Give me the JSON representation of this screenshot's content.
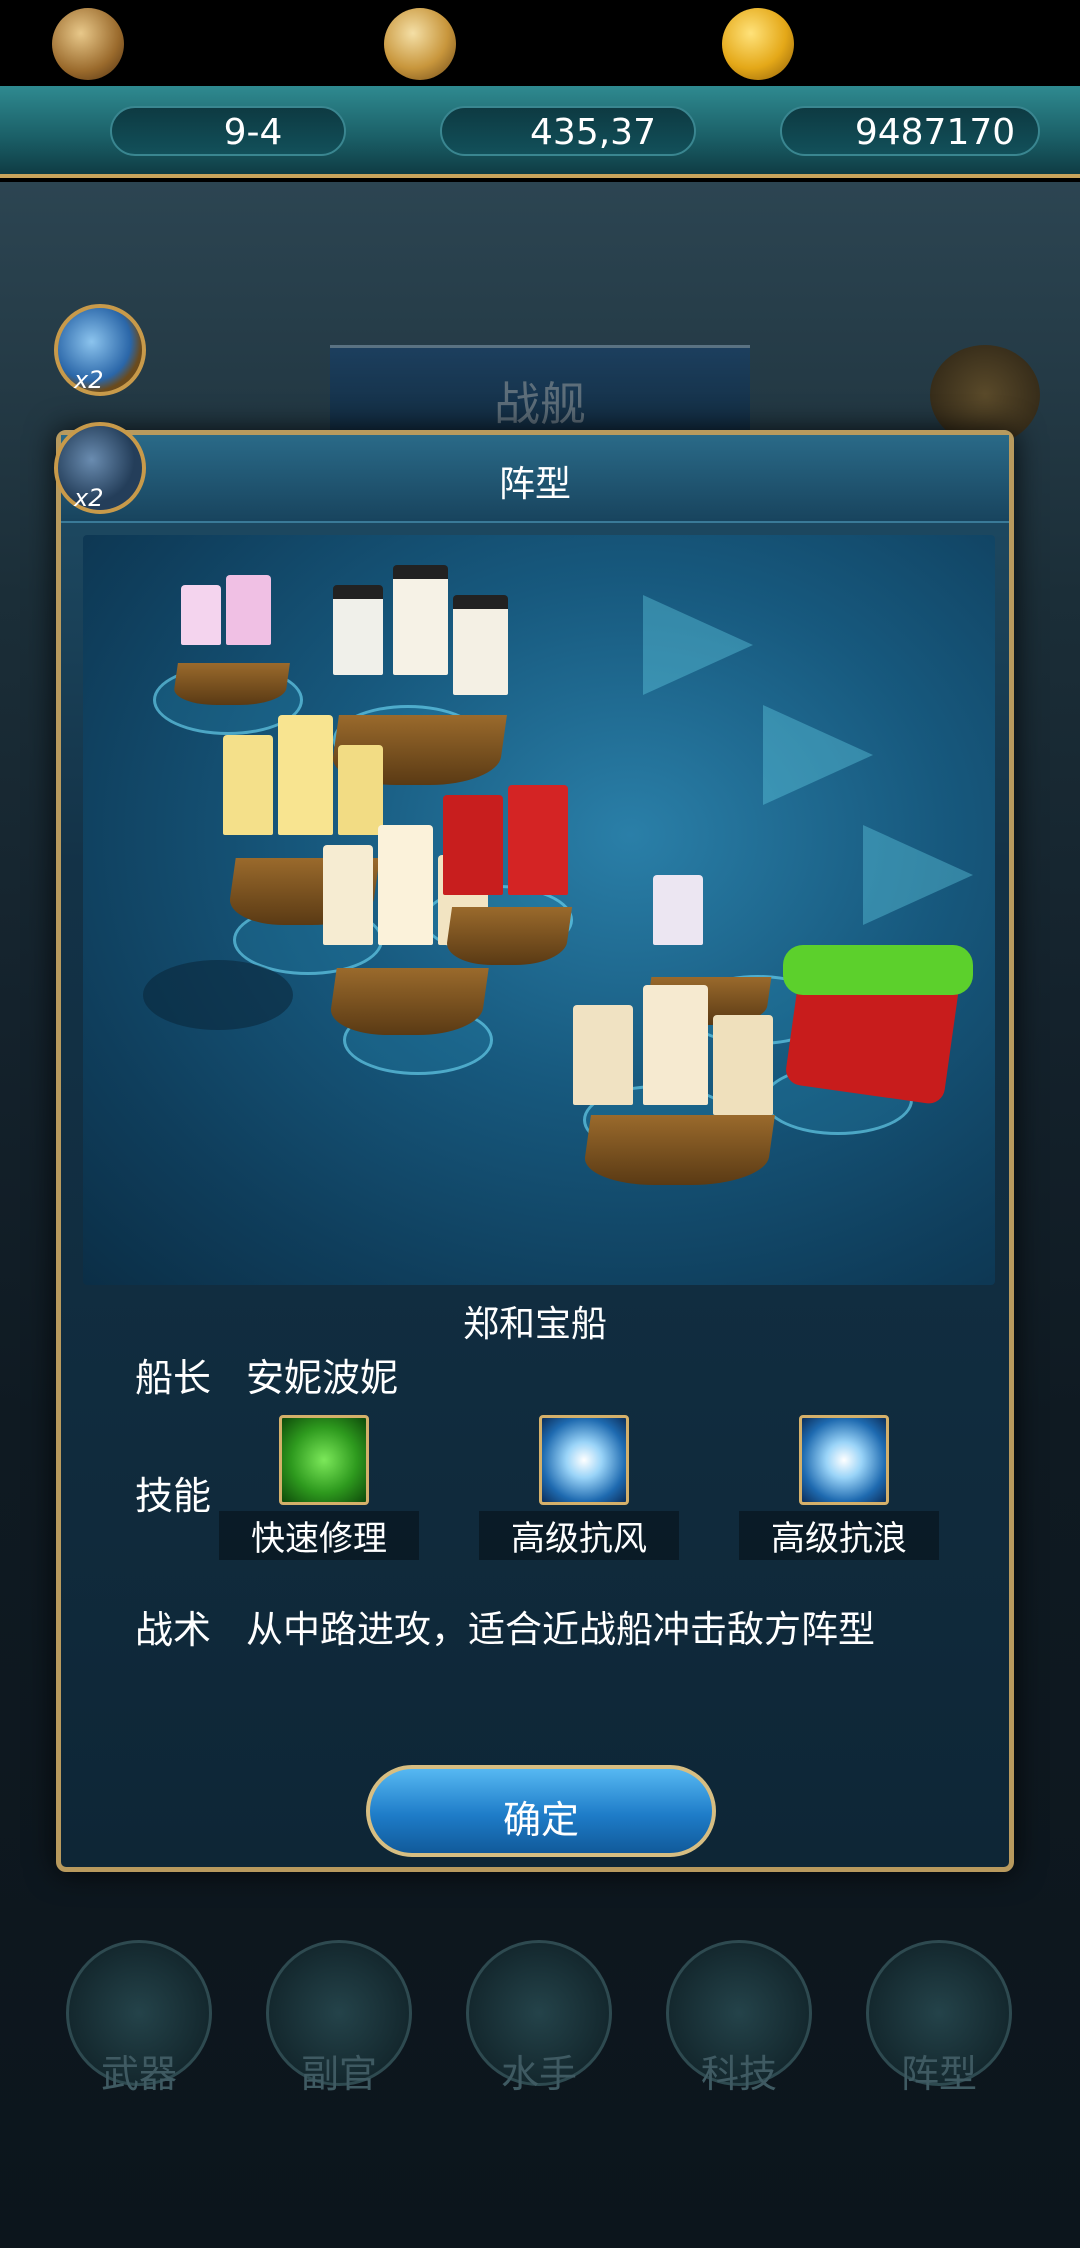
{
  "resources": {
    "stage": "9-4",
    "coordinates": "435,37",
    "gold": "9487170"
  },
  "side_buttons": {
    "search_multiplier": "x2",
    "battle_multiplier": "x2"
  },
  "background": {
    "banner_title": "战舰",
    "nav": [
      "武器",
      "副官",
      "水手",
      "科技",
      "阵型"
    ]
  },
  "dialog": {
    "title": "阵型",
    "ship_name": "郑和宝船",
    "captain_label": "船长",
    "captain_name": "安妮波妮",
    "skills_label": "技能",
    "skills": [
      {
        "label": "快速修理",
        "icon": "repair-icon"
      },
      {
        "label": "高级抗风",
        "icon": "wind-resist-icon"
      },
      {
        "label": "高级抗浪",
        "icon": "wave-resist-icon"
      }
    ],
    "tactic_label": "战术",
    "tactic_text": "从中路进攻，适合近战船冲击敌方阵型",
    "confirm_label": "确定"
  },
  "colors": {
    "frame_gold": "#b89a5e",
    "confirm_blue": "#1e7cc8",
    "resource_teal": "#1a5e66"
  }
}
